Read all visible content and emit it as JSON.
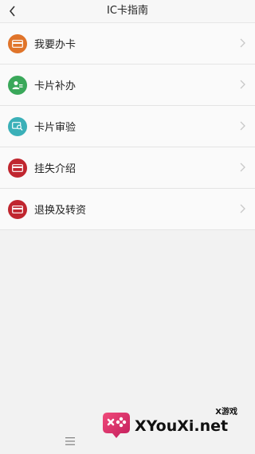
{
  "header": {
    "title": "IC卡指南"
  },
  "items": [
    {
      "label": "我要办卡",
      "color": "#e0742a"
    },
    {
      "label": "卡片补办",
      "color": "#3aa85a"
    },
    {
      "label": "卡片审验",
      "color": "#3bb0b8"
    },
    {
      "label": "挂失介绍",
      "color": "#c0262f"
    },
    {
      "label": "退换及转资",
      "color": "#c0262f"
    }
  ],
  "watermark": {
    "top": "X游戏",
    "text": "XYouXi.net"
  }
}
